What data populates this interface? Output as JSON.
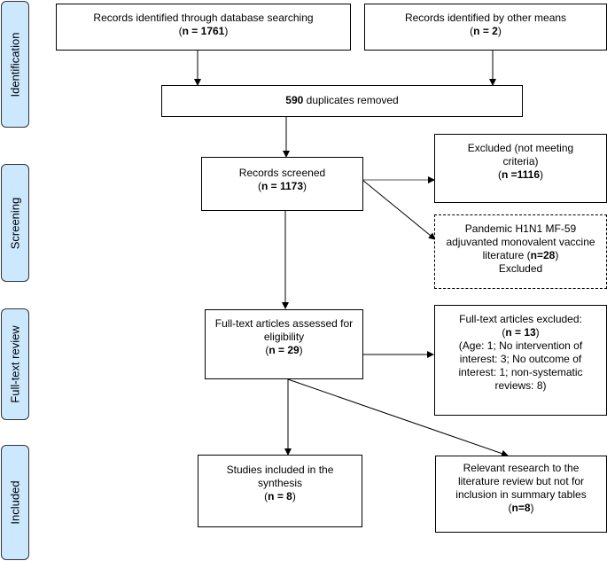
{
  "stages": [
    {
      "label": "Identification"
    },
    {
      "label": "Screening"
    },
    {
      "label": "Full-text review"
    },
    {
      "label": "Included"
    }
  ],
  "boxes": {
    "db_search": {
      "text": "Records identified through database searching",
      "n_label": "n = 1761"
    },
    "other_means": {
      "text": "Records identified by other means",
      "n_label": "n = 2"
    },
    "duplicates": {
      "n": "590",
      "text": "duplicates removed"
    },
    "screened": {
      "text": "Records screened",
      "n_label": "n = 1173"
    },
    "excluded": {
      "text": "Excluded (not meeting criteria)",
      "n_label": "n =1116"
    },
    "pandemic": {
      "text": "Pandemic H1N1 MF-59 adjuvanted monovalent vaccine literature",
      "n_label": "n=28",
      "suffix": "Excluded"
    },
    "fulltext": {
      "text": "Full-text articles assessed for eligibility",
      "n_label": "n = 29"
    },
    "fulltext_excluded": {
      "text": "Full-text articles excluded:",
      "n_label": "n = 13",
      "detail": "(Age: 1; No intervention of interest: 3; No outcome of interest: 1; non-systematic reviews: 8)"
    },
    "included": {
      "text": "Studies included in the synthesis",
      "n_label": "n = 8"
    },
    "relevant": {
      "text": "Relevant research to the literature review but not for inclusion in summary tables",
      "n_label": "n=8"
    }
  }
}
